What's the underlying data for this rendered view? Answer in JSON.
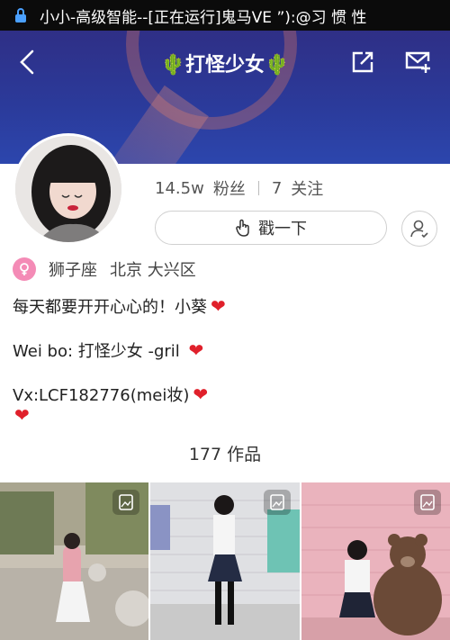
{
  "status_bar": {
    "text": "小小-高级智能--[正在运行]鬼马VE ”):@习 惯 性"
  },
  "header": {
    "title": "🌵打怪少女🌵",
    "back_icon": "chevron-left-icon",
    "share_icon": "share-out-icon",
    "mail_icon": "mail-icon"
  },
  "profile": {
    "fans_count": "14.5w",
    "fans_label": "粉丝",
    "following_count": "7",
    "following_label": "关注",
    "poke_label": "戳一下",
    "zodiac": "狮子座",
    "location": "北京 大兴区"
  },
  "bio": {
    "line1": "每天都要开开心心的！小葵",
    "line2": "Wei bo: 打怪少女 -gril ",
    "line3": "Vx:LCF182776(mei妆)",
    "heart": "❤"
  },
  "works": {
    "count": "177",
    "label": "作品"
  },
  "colors": {
    "header_bg": "#2c3c9e",
    "gender_badge": "#f48bb6",
    "heart": "#e0202b"
  }
}
